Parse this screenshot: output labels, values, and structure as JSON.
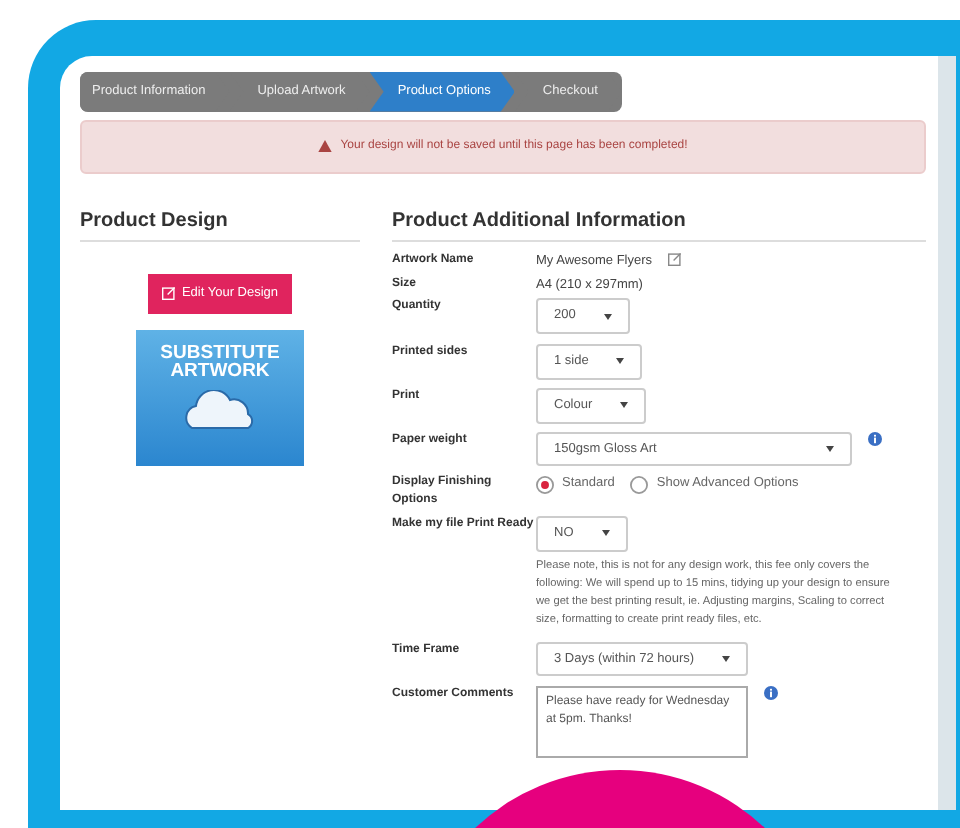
{
  "breadcrumb": [
    {
      "label": "Product Information",
      "selected": false
    },
    {
      "label": "Upload Artwork",
      "selected": false
    },
    {
      "label": "Product Options",
      "selected": true
    },
    {
      "label": "Checkout",
      "selected": false
    }
  ],
  "alert": {
    "text": "Your design will not be saved until this page has been completed!"
  },
  "sidebar": {
    "title": "Product Design",
    "edit_button": "Edit Your Design",
    "artwork_lines": [
      "SUBSTITUTE",
      "ARTWORK"
    ]
  },
  "form": {
    "title": "Product Additional Information",
    "rows": [
      {
        "kind": "editable-text",
        "label": "Artwork Name",
        "value": "My Awesome Flyers",
        "info": false
      },
      {
        "kind": "text",
        "label": "Size",
        "value": "A4 (210 x 297mm)",
        "info": false
      },
      {
        "kind": "select",
        "label": "Quantity",
        "value": "200",
        "info": false
      },
      {
        "kind": "select",
        "label": "Printed sides",
        "value": "1 side",
        "info": false
      },
      {
        "kind": "select",
        "label": "Print",
        "value": "Colour",
        "info": false
      },
      {
        "kind": "select",
        "label": "Paper weight",
        "value": "150gsm Gloss Art",
        "info": true
      },
      {
        "kind": "radio",
        "label": "Display Finishing Options",
        "options": [
          {
            "label": "Standard",
            "selected": true
          },
          {
            "label": "Show Advanced Options",
            "selected": false
          }
        ],
        "info": false
      },
      {
        "kind": "select",
        "label": "Make my file Print Ready",
        "value": "NO",
        "note": "Please note, this is not for any design work, this fee only covers the following: We will spend up to 15 mins, tidying up your design to ensure we get the best printing result, ie. Adjusting margins, Scaling to correct size, formatting to create print ready files, etc.",
        "info": false
      },
      {
        "kind": "select",
        "label": "Time Frame",
        "value": "3 Days (within 72 hours)",
        "info": false
      },
      {
        "kind": "textarea",
        "label": "Customer Comments",
        "value": "Please have ready for Wednesday at 5pm. Thanks!",
        "info": true
      }
    ]
  }
}
